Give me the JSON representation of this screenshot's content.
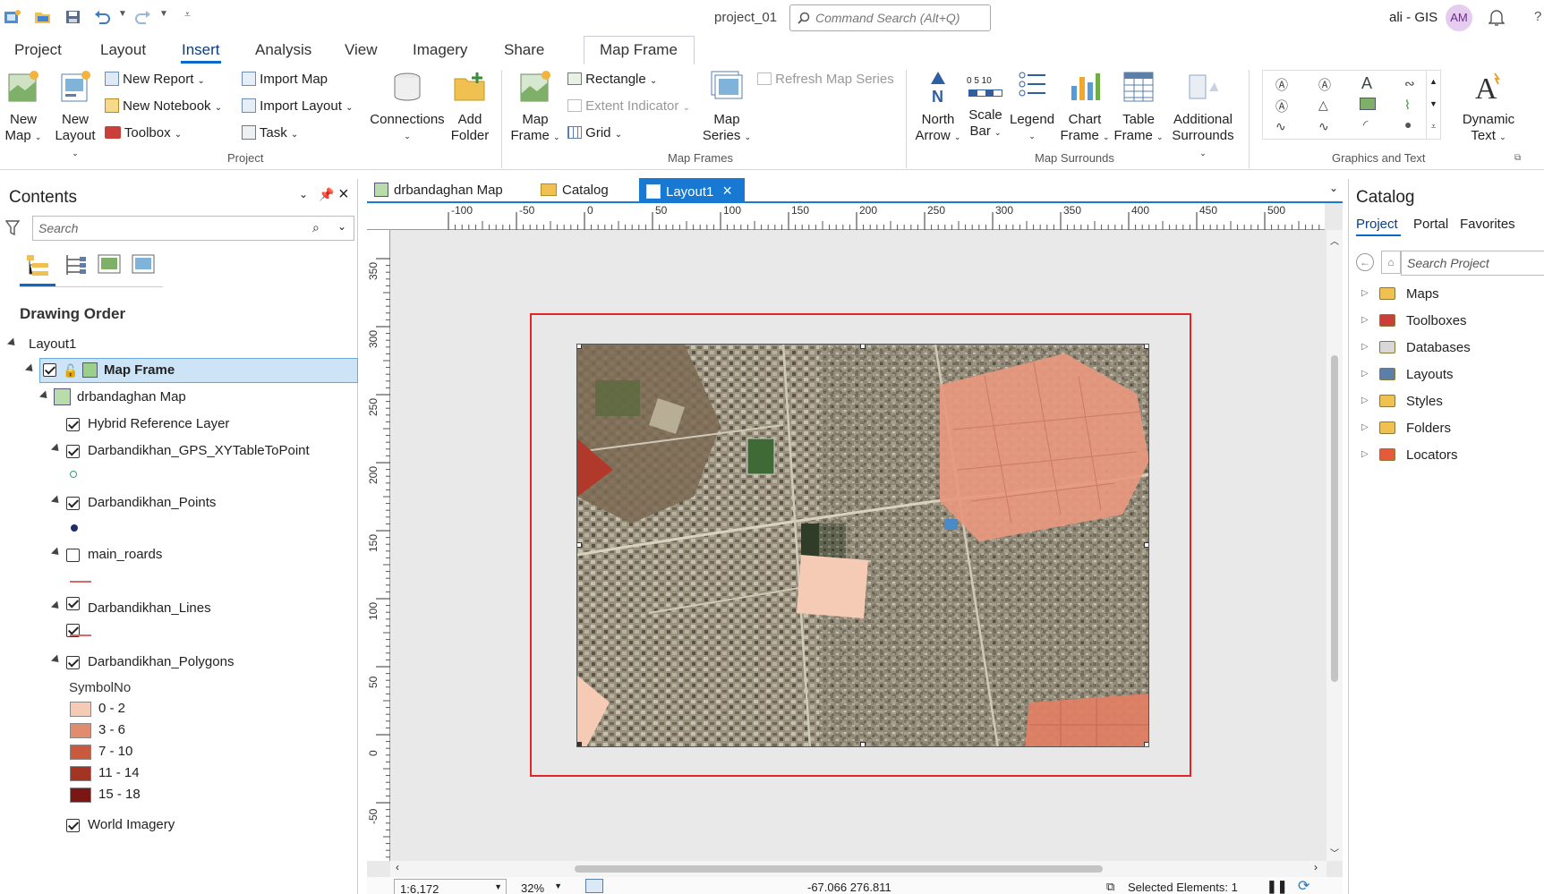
{
  "title_bar": {
    "project_name": "project_01",
    "command_search_placeholder": "Command Search (Alt+Q)",
    "user_name": "ali - GIS",
    "user_initials": "AM"
  },
  "ribbon_tabs": [
    "Project",
    "Layout",
    "Insert",
    "Analysis",
    "View",
    "Imagery",
    "Share",
    "Map Frame"
  ],
  "ribbon": {
    "project_group": {
      "label": "Project",
      "new_map": [
        "New",
        "Map"
      ],
      "new_layout": [
        "New",
        "Layout"
      ],
      "new_report": "New Report",
      "new_notebook": "New Notebook",
      "toolbox": "Toolbox",
      "import_map": "Import Map",
      "import_layout": "Import Layout",
      "task": "Task",
      "connections": "Connections",
      "add_folder": [
        "Add",
        "Folder"
      ]
    },
    "map_frames_group": {
      "label": "Map Frames",
      "map_frame": [
        "Map",
        "Frame"
      ],
      "rectangle": "Rectangle",
      "extent_indicator": "Extent Indicator",
      "grid": "Grid",
      "map_series": [
        "Map",
        "Series"
      ],
      "refresh_map_series": "Refresh Map Series"
    },
    "map_surrounds_group": {
      "label": "Map Surrounds",
      "north_arrow": [
        "North",
        "Arrow"
      ],
      "scale_bar": [
        "Scale",
        "Bar"
      ],
      "legend": "Legend",
      "chart_frame": [
        "Chart",
        "Frame"
      ],
      "table_frame": [
        "Table",
        "Frame"
      ],
      "additional_surrounds": [
        "Additional",
        "Surrounds"
      ],
      "scale_bar_ticks": "0  5  10"
    },
    "graphics_group": {
      "label": "Graphics and Text",
      "dynamic_text": [
        "Dynamic",
        "Text"
      ]
    }
  },
  "contents": {
    "title": "Contents",
    "search_placeholder": "Search",
    "drawing_order_label": "Drawing Order",
    "layout_name": "Layout1",
    "map_frame": "Map Frame",
    "map_name": "drbandaghan Map",
    "layers": [
      {
        "name": "Hybrid Reference Layer",
        "checked": true
      },
      {
        "name": "Darbandikhan_GPS_XYTableToPoint",
        "checked": true
      },
      {
        "name": "Darbandikhan_Points",
        "checked": true
      },
      {
        "name": "main_roards",
        "checked": false
      },
      {
        "name": "Darbandikhan_Lines",
        "checked": true
      },
      {
        "name": "Darbandikhan_Polygons",
        "checked": true
      },
      {
        "name": "World Imagery",
        "checked": true
      }
    ],
    "symbol_field": "SymbolNo",
    "classes": [
      {
        "label": "0 - 2",
        "color": "#f6cbb5"
      },
      {
        "label": "3 - 6",
        "color": "#df8d6e"
      },
      {
        "label": "7 - 10",
        "color": "#c95a3d"
      },
      {
        "label": "11 - 14",
        "color": "#a33423"
      },
      {
        "label": "15 - 18",
        "color": "#7a1613"
      }
    ]
  },
  "doc_tabs": [
    "drbandaghan Map",
    "Catalog",
    "Layout1"
  ],
  "ruler": {
    "h_ticks": [
      "-100",
      "-50",
      "0",
      "50",
      "100",
      "150",
      "200",
      "250",
      "300",
      "350",
      "400",
      "450",
      "500"
    ],
    "v_ticks": [
      "350",
      "300",
      "250",
      "200",
      "150",
      "100",
      "50",
      "0",
      "-50"
    ]
  },
  "status_bar": {
    "scale": "1:6,172",
    "zoom": "32%",
    "coordinates": "-67.066  276.811",
    "selected": "Selected Elements: 1"
  },
  "catalog": {
    "title": "Catalog",
    "tabs": [
      "Project",
      "Portal",
      "Favorites"
    ],
    "search_placeholder": "Search Project",
    "items": [
      "Maps",
      "Toolboxes",
      "Databases",
      "Layouts",
      "Styles",
      "Folders",
      "Locators"
    ]
  },
  "colors": {
    "accent": "#0b6ac9",
    "active_tab": "#1779d2",
    "selection": "#cde4f7",
    "page_border": "#e0262b"
  }
}
